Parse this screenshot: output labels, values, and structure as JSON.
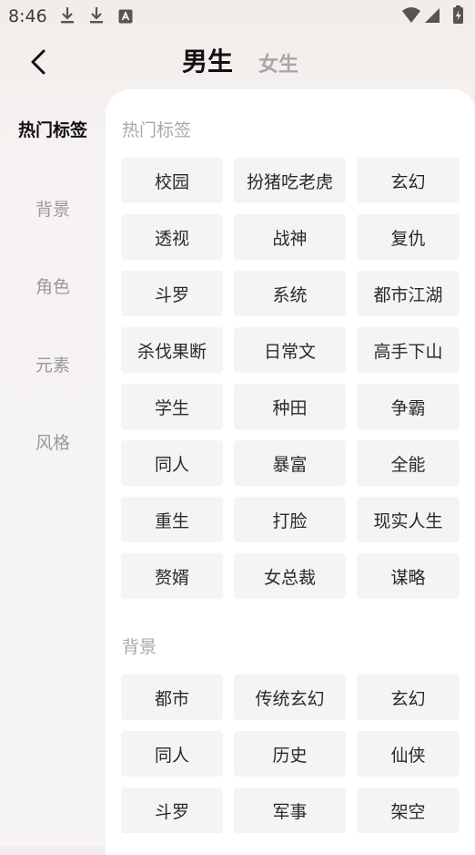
{
  "status_bar": {
    "time": "8:46",
    "icons": [
      "download-icon",
      "download-icon",
      "a-badge-icon",
      "wifi-icon",
      "signal-icon",
      "battery-charging-icon"
    ]
  },
  "header": {
    "back": "chevron-left-icon",
    "tabs": [
      {
        "label": "男生",
        "active": true
      },
      {
        "label": "女生",
        "active": false
      }
    ]
  },
  "sidebar": {
    "items": [
      {
        "label": "热门标签",
        "active": true
      },
      {
        "label": "背景",
        "active": false
      },
      {
        "label": "角色",
        "active": false
      },
      {
        "label": "元素",
        "active": false
      },
      {
        "label": "风格",
        "active": false
      }
    ]
  },
  "sections": [
    {
      "title": "热门标签",
      "tags": [
        "校园",
        "扮猪吃老虎",
        "玄幻",
        "透视",
        "战神",
        "复仇",
        "斗罗",
        "系统",
        "都市江湖",
        "杀伐果断",
        "日常文",
        "高手下山",
        "学生",
        "种田",
        "争霸",
        "同人",
        "暴富",
        "全能",
        "重生",
        "打脸",
        "现实人生",
        "赘婿",
        "女总裁",
        "谋略"
      ]
    },
    {
      "title": "背景",
      "tags": [
        "都市",
        "传统玄幻",
        "玄幻",
        "同人",
        "历史",
        "仙侠",
        "斗罗",
        "军事",
        "架空"
      ]
    }
  ],
  "colors": {
    "active_text": "#111111",
    "inactive_text": "#9a9a9a",
    "chip_bg": "#f4f4f4",
    "panel_bg": "#ffffff"
  }
}
